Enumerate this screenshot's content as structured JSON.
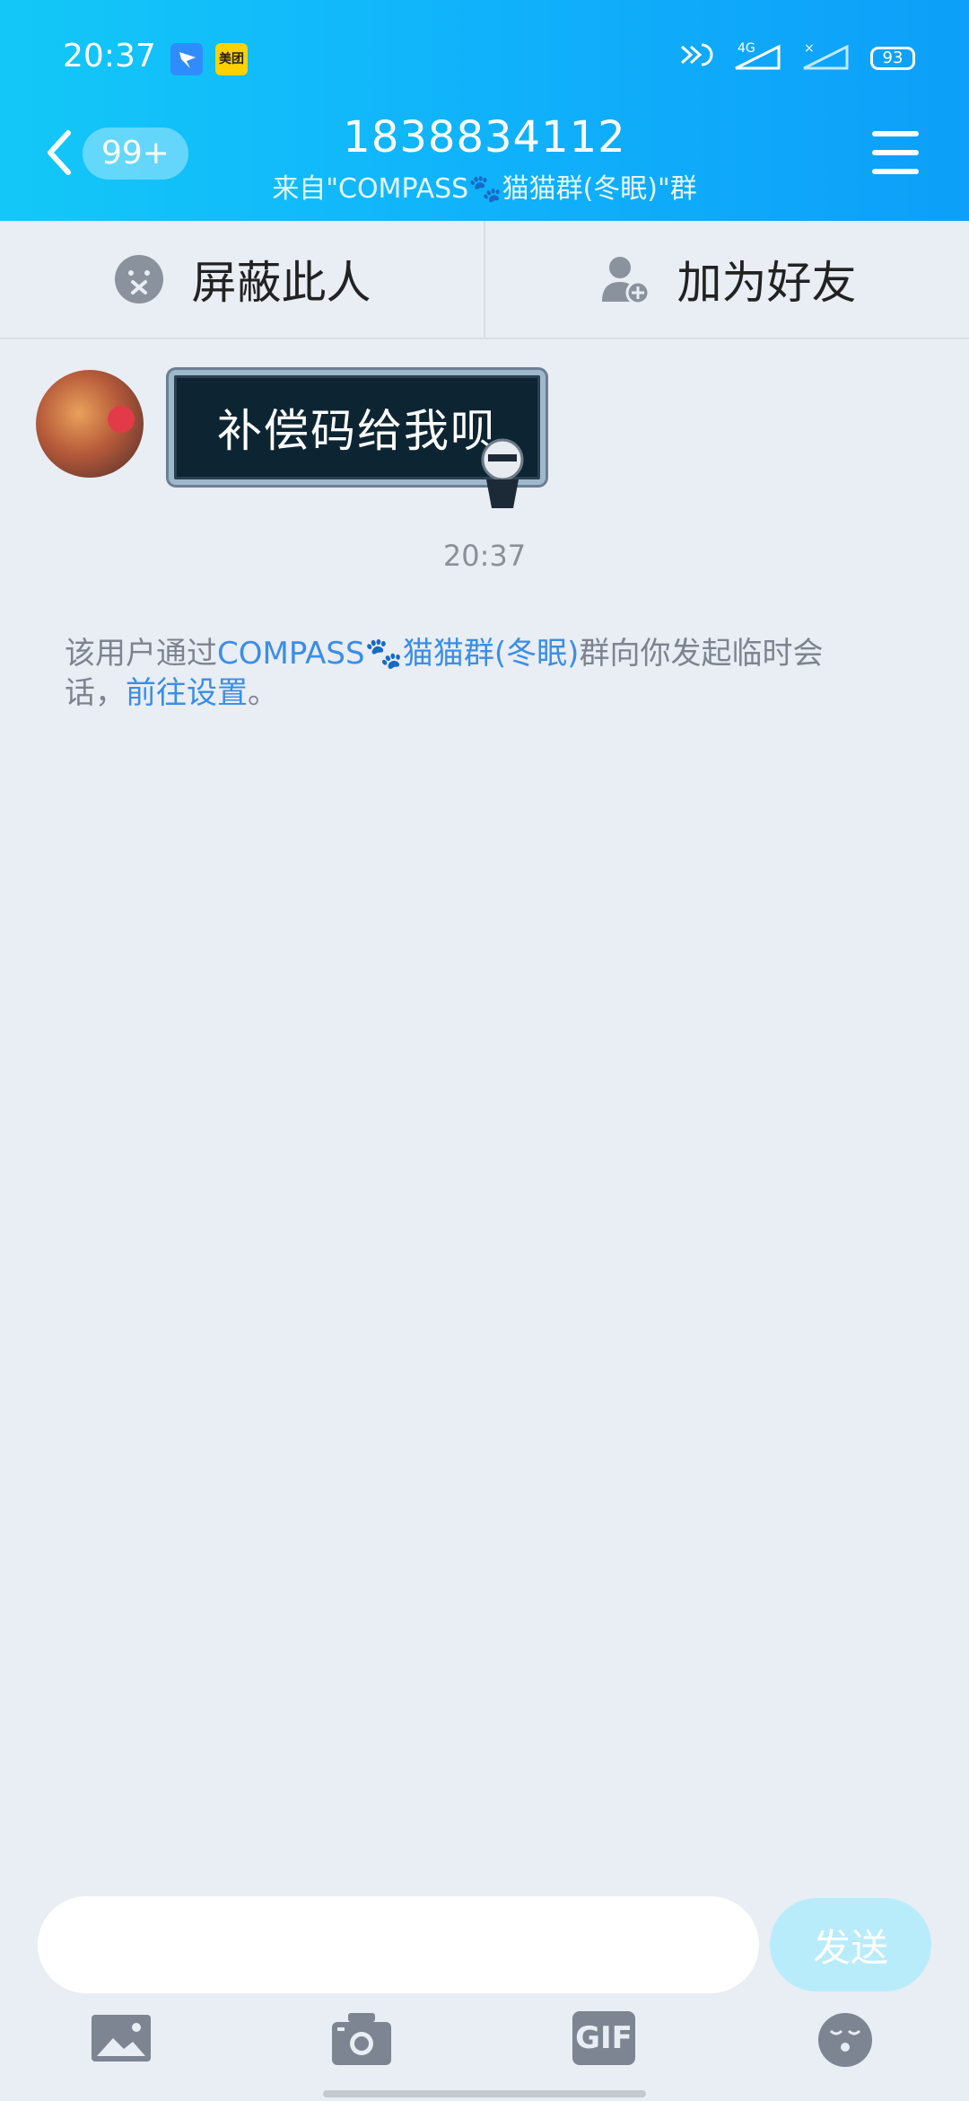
{
  "status_bar": {
    "time": "20:37",
    "app_icons": [
      "dingtalk-icon",
      "meituan-icon"
    ],
    "meituan_label": "美团",
    "network_label": "4G",
    "battery": "93"
  },
  "header": {
    "unread_count": "99+",
    "title": "1838834112",
    "subtitle": "来自\"COMPASS🐾猫猫群(冬眠)\"群"
  },
  "actions": {
    "block_label": "屏蔽此人",
    "add_friend_label": "加为好友"
  },
  "chat": {
    "message_text": "补偿码给我呗",
    "timestamp": "20:37",
    "notice_prefix": "该用户通过",
    "notice_group": "COMPASS🐾猫猫群(冬眠)",
    "notice_middle": "群向你发起临时会话，",
    "notice_link": "前往设置",
    "notice_suffix": "。"
  },
  "input": {
    "placeholder": "",
    "send_label": "发送"
  },
  "toolbar": {
    "gif_label": "GIF",
    "items": [
      "image-icon",
      "camera-icon",
      "gif-icon",
      "emoji-icon"
    ]
  },
  "colors": {
    "header_gradient_start": "#13c8f8",
    "header_gradient_end": "#0d9ff9",
    "link": "#3a8ee6",
    "send_button": "#b9ecfb",
    "background": "#e9edf4"
  }
}
